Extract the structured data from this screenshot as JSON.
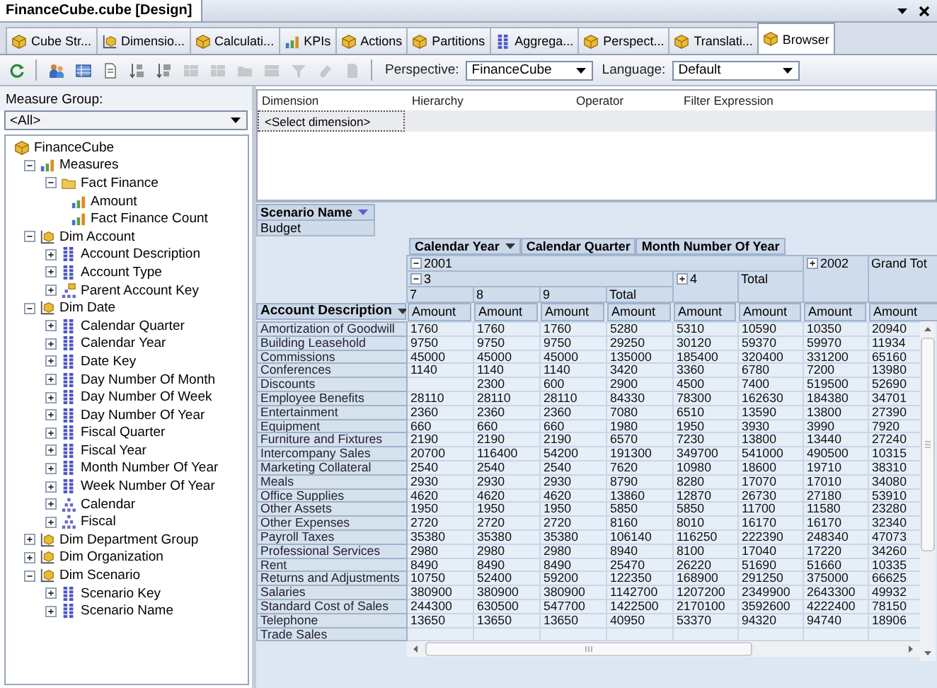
{
  "document_tab": {
    "title": "FinanceCube.cube [Design]"
  },
  "tabs": [
    {
      "label": "Cube Str...",
      "selected": false
    },
    {
      "label": "Dimensio...",
      "selected": false
    },
    {
      "label": "Calculati...",
      "selected": false
    },
    {
      "label": "KPIs",
      "selected": false
    },
    {
      "label": "Actions",
      "selected": false
    },
    {
      "label": "Partitions",
      "selected": false
    },
    {
      "label": "Aggrega...",
      "selected": false
    },
    {
      "label": "Perspect...",
      "selected": false
    },
    {
      "label": "Translati...",
      "selected": false
    },
    {
      "label": "Browser",
      "selected": true
    }
  ],
  "toolbar": {
    "buttons": [
      {
        "disabled": false
      },
      {
        "disabled": false
      },
      {
        "disabled": false
      },
      {
        "disabled": false
      },
      {
        "disabled": false
      },
      {
        "disabled": false
      },
      {
        "disabled": true
      },
      {
        "disabled": true
      },
      {
        "disabled": true
      },
      {
        "disabled": true
      },
      {
        "disabled": true
      },
      {
        "disabled": true
      },
      {
        "disabled": true
      }
    ],
    "perspective": {
      "label": "Perspective:",
      "value": "FinanceCube"
    },
    "language": {
      "label": "Language:",
      "value": "Default"
    }
  },
  "sidebar": {
    "measure_group": {
      "label": "Measure Group:",
      "value": "<All>"
    },
    "tree": [
      {
        "label": "FinanceCube",
        "kind": "cube",
        "children": [
          {
            "label": "Measures",
            "kind": "measures",
            "expanded": true,
            "children": [
              {
                "label": "Fact Finance",
                "kind": "folder",
                "expanded": true,
                "children": [
                  {
                    "label": "Amount",
                    "kind": "measure"
                  },
                  {
                    "label": "Fact Finance Count",
                    "kind": "measure"
                  }
                ]
              }
            ]
          },
          {
            "label": "Dim Account",
            "kind": "dimension",
            "expanded": true,
            "children": [
              {
                "label": "Account Description",
                "kind": "attribute",
                "expanded": false
              },
              {
                "label": "Account Type",
                "kind": "attribute",
                "expanded": false
              },
              {
                "label": "Parent Account Key",
                "kind": "parent",
                "expanded": false
              }
            ]
          },
          {
            "label": "Dim Date",
            "kind": "dimension",
            "expanded": true,
            "children": [
              {
                "label": "Calendar Quarter",
                "kind": "attribute",
                "expanded": false
              },
              {
                "label": "Calendar Year",
                "kind": "attribute",
                "expanded": false
              },
              {
                "label": "Date Key",
                "kind": "attribute",
                "expanded": false
              },
              {
                "label": "Day Number Of Month",
                "kind": "attribute",
                "expanded": false
              },
              {
                "label": "Day Number Of Week",
                "kind": "attribute",
                "expanded": false
              },
              {
                "label": "Day Number Of Year",
                "kind": "attribute",
                "expanded": false
              },
              {
                "label": "Fiscal Quarter",
                "kind": "attribute",
                "expanded": false
              },
              {
                "label": "Fiscal Year",
                "kind": "attribute",
                "expanded": false
              },
              {
                "label": "Month Number Of Year",
                "kind": "attribute",
                "expanded": false
              },
              {
                "label": "Week Number Of Year",
                "kind": "attribute",
                "expanded": false
              },
              {
                "label": "Calendar",
                "kind": "hierarchy",
                "expanded": false
              },
              {
                "label": "Fiscal",
                "kind": "hierarchy",
                "expanded": false
              }
            ]
          },
          {
            "label": "Dim Department Group",
            "kind": "dimension",
            "expanded": false
          },
          {
            "label": "Dim Organization",
            "kind": "dimension",
            "expanded": false
          },
          {
            "label": "Dim Scenario",
            "kind": "dimension",
            "expanded": true,
            "children": [
              {
                "label": "Scenario Key",
                "kind": "attribute",
                "expanded": false
              },
              {
                "label": "Scenario Name",
                "kind": "attribute",
                "expanded": false
              }
            ]
          }
        ]
      }
    ]
  },
  "filter_grid": {
    "columns": [
      "Dimension",
      "Hierarchy",
      "Operator",
      "Filter Expression"
    ],
    "placeholder_row": "<Select dimension>"
  },
  "pivot": {
    "filter_field": {
      "label": "Scenario Name",
      "value": "Budget"
    },
    "column_fields": [
      {
        "label": "Calendar Year",
        "dropdown": true
      },
      {
        "label": "Calendar Quarter",
        "dropdown": false
      },
      {
        "label": "Month Number Of Year",
        "dropdown": false
      }
    ],
    "years": [
      {
        "label": "2001",
        "expanded": true
      },
      {
        "label": "2002",
        "expanded": false
      }
    ],
    "grand_total": "Grand Tot",
    "quarters": [
      {
        "label": "3",
        "expanded": true
      },
      {
        "label": "4",
        "expanded": false
      }
    ],
    "year_total": "Total",
    "months": [
      "7",
      "8",
      "9"
    ],
    "quarter_total": "Total",
    "row_field": {
      "label": "Account Description",
      "dropdown": true
    },
    "measures": [
      "Amount",
      "Amount",
      "Amount",
      "Amount",
      "Amount",
      "Amount",
      "Amount",
      "Amount"
    ],
    "rows": [
      {
        "label": "Amortization of Goodwill",
        "month_7": "1760",
        "month_8": "1760",
        "month_9": "1760",
        "q3_total": "5280",
        "q4": "5310",
        "y2001_total": "10590",
        "y2002": "10350",
        "grand_total": "20940"
      },
      {
        "label": "Building Leasehold",
        "month_7": "9750",
        "month_8": "9750",
        "month_9": "9750",
        "q3_total": "29250",
        "q4": "30120",
        "y2001_total": "59370",
        "y2002": "59970",
        "grand_total": "11934"
      },
      {
        "label": "Commissions",
        "month_7": "45000",
        "month_8": "45000",
        "month_9": "45000",
        "q3_total": "135000",
        "q4": "185400",
        "y2001_total": "320400",
        "y2002": "331200",
        "grand_total": "65160"
      },
      {
        "label": "Conferences",
        "month_7": "1140",
        "month_8": "1140",
        "month_9": "1140",
        "q3_total": "3420",
        "q4": "3360",
        "y2001_total": "6780",
        "y2002": "7200",
        "grand_total": "13980"
      },
      {
        "label": "Discounts",
        "month_8": "2300",
        "month_9": "600",
        "q3_total": "2900",
        "q4": "4500",
        "y2001_total": "7400",
        "y2002": "519500",
        "grand_total": "52690"
      },
      {
        "label": "Employee Benefits",
        "month_7": "28110",
        "month_8": "28110",
        "month_9": "28110",
        "q3_total": "84330",
        "q4": "78300",
        "y2001_total": "162630",
        "y2002": "184380",
        "grand_total": "34701"
      },
      {
        "label": "Entertainment",
        "month_7": "2360",
        "month_8": "2360",
        "month_9": "2360",
        "q3_total": "7080",
        "q4": "6510",
        "y2001_total": "13590",
        "y2002": "13800",
        "grand_total": "27390"
      },
      {
        "label": "Equipment",
        "month_7": "660",
        "month_8": "660",
        "month_9": "660",
        "q3_total": "1980",
        "q4": "1950",
        "y2001_total": "3930",
        "y2002": "3990",
        "grand_total": "7920"
      },
      {
        "label": "Furniture and Fixtures",
        "month_7": "2190",
        "month_8": "2190",
        "month_9": "2190",
        "q3_total": "6570",
        "q4": "7230",
        "y2001_total": "13800",
        "y2002": "13440",
        "grand_total": "27240"
      },
      {
        "label": "Intercompany Sales",
        "month_7": "20700",
        "month_8": "116400",
        "month_9": "54200",
        "q3_total": "191300",
        "q4": "349700",
        "y2001_total": "541000",
        "y2002": "490500",
        "grand_total": "10315"
      },
      {
        "label": "Marketing Collateral",
        "month_7": "2540",
        "month_8": "2540",
        "month_9": "2540",
        "q3_total": "7620",
        "q4": "10980",
        "y2001_total": "18600",
        "y2002": "19710",
        "grand_total": "38310"
      },
      {
        "label": "Meals",
        "month_7": "2930",
        "month_8": "2930",
        "month_9": "2930",
        "q3_total": "8790",
        "q4": "8280",
        "y2001_total": "17070",
        "y2002": "17010",
        "grand_total": "34080"
      },
      {
        "label": "Office Supplies",
        "month_7": "4620",
        "month_8": "4620",
        "month_9": "4620",
        "q3_total": "13860",
        "q4": "12870",
        "y2001_total": "26730",
        "y2002": "27180",
        "grand_total": "53910"
      },
      {
        "label": "Other Assets",
        "month_7": "1950",
        "month_8": "1950",
        "month_9": "1950",
        "q3_total": "5850",
        "q4": "5850",
        "y2001_total": "11700",
        "y2002": "11580",
        "grand_total": "23280"
      },
      {
        "label": "Other Expenses",
        "month_7": "2720",
        "month_8": "2720",
        "month_9": "2720",
        "q3_total": "8160",
        "q4": "8010",
        "y2001_total": "16170",
        "y2002": "16170",
        "grand_total": "32340"
      },
      {
        "label": "Payroll Taxes",
        "month_7": "35380",
        "month_8": "35380",
        "month_9": "35380",
        "q3_total": "106140",
        "q4": "116250",
        "y2001_total": "222390",
        "y2002": "248340",
        "grand_total": "47073"
      },
      {
        "label": "Professional Services",
        "month_7": "2980",
        "month_8": "2980",
        "month_9": "2980",
        "q3_total": "8940",
        "q4": "8100",
        "y2001_total": "17040",
        "y2002": "17220",
        "grand_total": "34260"
      },
      {
        "label": "Rent",
        "month_7": "8490",
        "month_8": "8490",
        "month_9": "8490",
        "q3_total": "25470",
        "q4": "26220",
        "y2001_total": "51690",
        "y2002": "51660",
        "grand_total": "10335"
      },
      {
        "label": "Returns and Adjustments",
        "month_7": "10750",
        "month_8": "52400",
        "month_9": "59200",
        "q3_total": "122350",
        "q4": "168900",
        "y2001_total": "291250",
        "y2002": "375000",
        "grand_total": "66625"
      },
      {
        "label": "Salaries",
        "month_7": "380900",
        "month_8": "380900",
        "month_9": "380900",
        "q3_total": "1142700",
        "q4": "1207200",
        "y2001_total": "2349900",
        "y2002": "2643300",
        "grand_total": "49932"
      },
      {
        "label": "Standard Cost of Sales",
        "month_7": "244300",
        "month_8": "630500",
        "month_9": "547700",
        "q3_total": "1422500",
        "q4": "2170100",
        "y2001_total": "3592600",
        "y2002": "4222400",
        "grand_total": "78150"
      },
      {
        "label": "Telephone",
        "month_7": "13650",
        "month_8": "13650",
        "month_9": "13650",
        "q3_total": "40950",
        "q4": "53370",
        "y2001_total": "94320",
        "y2002": "94740",
        "grand_total": "18906"
      },
      {
        "label": "Trade Sales"
      }
    ]
  }
}
